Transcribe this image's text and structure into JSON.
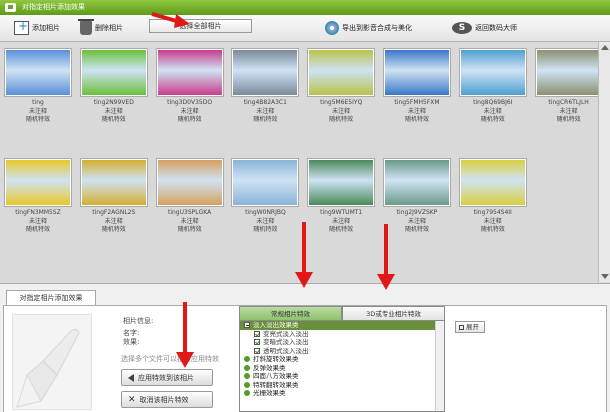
{
  "window": {
    "title": "对指定相片添加效果"
  },
  "toolbar": {
    "add_photo": "添加相片",
    "delete_photo": "删除相片",
    "select_all": "选择全部相片",
    "export": "导出到影音合成与美化",
    "back": "返回数码大师"
  },
  "photos": [
    {
      "name": "ting",
      "note": "未注释",
      "effect": "随机特效"
    },
    {
      "name": "ting2N99VED",
      "note": "未注释",
      "effect": "随机特效"
    },
    {
      "name": "ting3D0V35DO",
      "note": "未注释",
      "effect": "随机特效"
    },
    {
      "name": "ting4B82A3C1",
      "note": "未注释",
      "effect": "随机特效"
    },
    {
      "name": "ting5M6E5IYQ",
      "note": "未注释",
      "effect": "随机特效"
    },
    {
      "name": "ting5FMH5FXM",
      "note": "未注释",
      "effect": "随机特效"
    },
    {
      "name": "ting8Q69BJ6I",
      "note": "未注释",
      "effect": "随机特效"
    },
    {
      "name": "tingCR6TLJLH",
      "note": "未注释",
      "effect": "随机特效"
    },
    {
      "name": "tingFN3MM5SZ",
      "note": "未注释",
      "effect": "随机特效"
    },
    {
      "name": "tingF2AGNL2S",
      "note": "未注释",
      "effect": "随机特效"
    },
    {
      "name": "tingU3SPLGKA",
      "note": "未注释",
      "effect": "随机特效"
    },
    {
      "name": "tingW0NRJBQ",
      "note": "未注释",
      "effect": "随机特效"
    },
    {
      "name": "ting9WTUMT1",
      "note": "未注释",
      "effect": "随机特效"
    },
    {
      "name": "ting2J9VZSKP",
      "note": "未注释",
      "effect": "随机特效"
    },
    {
      "name": "ting7954S4II",
      "note": "未注释",
      "effect": "随机特效"
    }
  ],
  "thumbs": [
    "#5a8fd8",
    "#6bbf3a",
    "#c83c8c",
    "#7a8a9a",
    "#b8c24a",
    "#3a76c8",
    "#4f9fd0",
    "#8a9070",
    "#e8c82a",
    "#d4b030",
    "#d6a060",
    "#8ab4d8",
    "#4a8a5a",
    "#6a9a8a",
    "#d8d040"
  ],
  "bottom": {
    "tab_label": "对指定相片添加效果",
    "photo_info": "相片信息:",
    "name_label": "名字:",
    "effect_label": "效果:",
    "hint": "选择多个文件可以批量应用特效",
    "apply_button": "应用特效到该相片",
    "cancel_button": "取消该相片特效",
    "tab_common": "常规相片特效",
    "tab_3d": "3D或专业相片特效",
    "expand": "展开"
  },
  "effects": [
    {
      "label": "淡入淡出效果类",
      "kind": "category-open"
    },
    {
      "label": "变亮式淡入淡出",
      "kind": "item"
    },
    {
      "label": "变暗式淡入淡出",
      "kind": "item"
    },
    {
      "label": "透明式淡入淡出",
      "kind": "item"
    },
    {
      "label": "打斜旋转效果类",
      "kind": "category"
    },
    {
      "label": "反弹效果类",
      "kind": "category"
    },
    {
      "label": "四面八方效果类",
      "kind": "category"
    },
    {
      "label": "特转翻转效果类",
      "kind": "category"
    },
    {
      "label": "光栅效果类",
      "kind": "category"
    }
  ]
}
